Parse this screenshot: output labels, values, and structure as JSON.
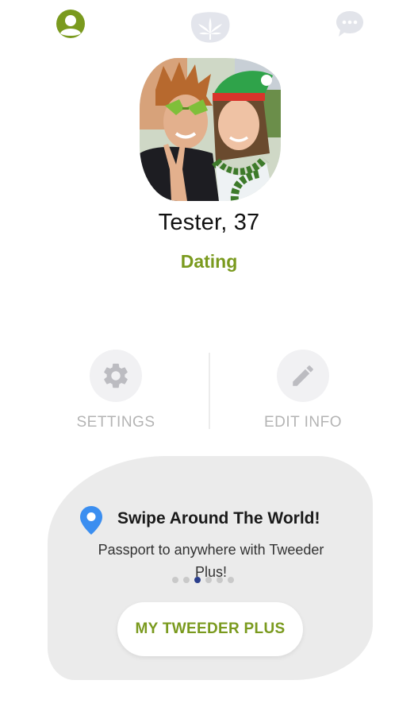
{
  "nav": {
    "profile_icon": "person-circle-icon",
    "leaf_icon": "cannabis-leaf-icon",
    "chat_icon": "chat-bubble-icon",
    "active_color": "#7a9a1e",
    "inactive_color": "#e2e4ea"
  },
  "profile": {
    "name": "Tester, 37",
    "status": "Dating",
    "photo": "profile-photo"
  },
  "actions": {
    "settings_label": "SETTINGS",
    "settings_icon": "gear-icon",
    "edit_label": "EDIT INFO",
    "edit_icon": "pencil-icon"
  },
  "promo": {
    "icon": "location-pin-icon",
    "title": "Swipe Around The World!",
    "subtitle": "Passport to anywhere with Tweeder Plus!",
    "carousel_active_index": 2,
    "carousel_count": 6,
    "button_label": "MY TWEEDER PLUS"
  },
  "colors": {
    "accent_green": "#7a9a1e",
    "pin_blue": "#3b8ef0",
    "card_bg": "#ebebeb",
    "dot_active": "#2b3f8c"
  }
}
